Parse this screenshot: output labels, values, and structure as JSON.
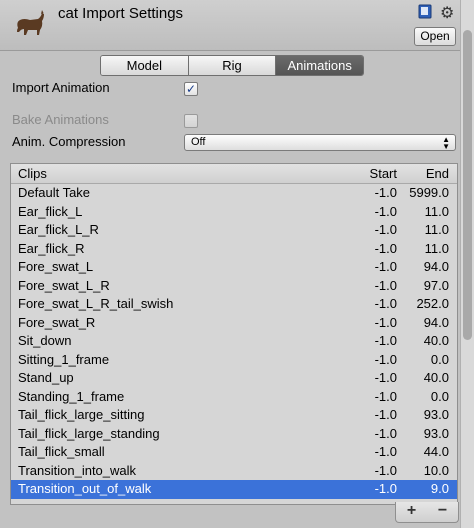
{
  "header": {
    "title": "cat Import Settings",
    "open_label": "Open"
  },
  "tabs": [
    "Model",
    "Rig",
    "Animations"
  ],
  "active_tab": "Animations",
  "settings": {
    "import_animation_label": "Import Animation",
    "import_animation_checked": "✓",
    "bake_animations_label": "Bake Animations",
    "anim_compression_label": "Anim. Compression",
    "anim_compression_value": "Off"
  },
  "clips": {
    "headers": {
      "name": "Clips",
      "start": "Start",
      "end": "End"
    },
    "rows": [
      {
        "name": "Default Take",
        "start": "-1.0",
        "end": "5999.0"
      },
      {
        "name": "Ear_flick_L",
        "start": "-1.0",
        "end": "11.0"
      },
      {
        "name": "Ear_flick_L_R",
        "start": "-1.0",
        "end": "11.0"
      },
      {
        "name": "Ear_flick_R",
        "start": "-1.0",
        "end": "11.0"
      },
      {
        "name": "Fore_swat_L",
        "start": "-1.0",
        "end": "94.0"
      },
      {
        "name": "Fore_swat_L_R",
        "start": "-1.0",
        "end": "97.0"
      },
      {
        "name": "Fore_swat_L_R_tail_swish",
        "start": "-1.0",
        "end": "252.0"
      },
      {
        "name": "Fore_swat_R",
        "start": "-1.0",
        "end": "94.0"
      },
      {
        "name": "Sit_down",
        "start": "-1.0",
        "end": "40.0"
      },
      {
        "name": "Sitting_1_frame",
        "start": "-1.0",
        "end": "0.0"
      },
      {
        "name": "Stand_up",
        "start": "-1.0",
        "end": "40.0"
      },
      {
        "name": "Standing_1_frame",
        "start": "-1.0",
        "end": "0.0"
      },
      {
        "name": "Tail_flick_large_sitting",
        "start": "-1.0",
        "end": "93.0"
      },
      {
        "name": "Tail_flick_large_standing",
        "start": "-1.0",
        "end": "93.0"
      },
      {
        "name": "Tail_flick_small",
        "start": "-1.0",
        "end": "44.0"
      },
      {
        "name": "Transition_into_walk",
        "start": "-1.0",
        "end": "10.0"
      },
      {
        "name": "Transition_out_of_walk",
        "start": "-1.0",
        "end": "9.0"
      }
    ],
    "selected": "Transition_out_of_walk",
    "add_label": "+",
    "remove_label": "−"
  },
  "colors": {
    "selection": "#3b72d9",
    "checkmark": "#1b3f8c"
  },
  "icons": {
    "asset": "cat-icon",
    "help": "book-icon",
    "settings": "gear-icon"
  }
}
